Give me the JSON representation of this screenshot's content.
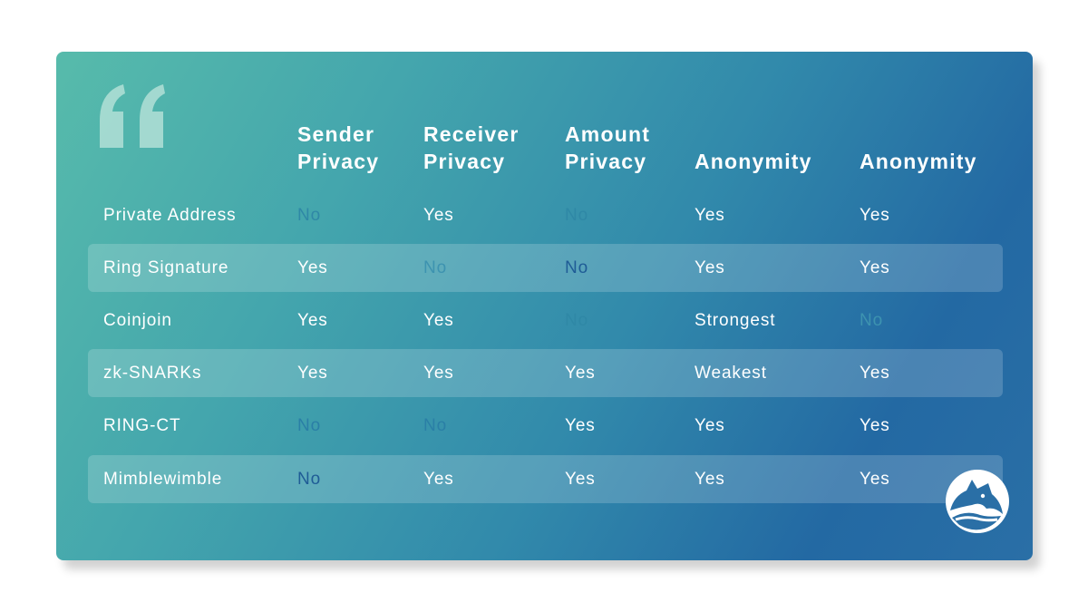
{
  "columns": [
    {
      "line1": "Sender",
      "line2": "Privacy"
    },
    {
      "line1": "Receiver",
      "line2": "Privacy"
    },
    {
      "line1": "Amount",
      "line2": "Privacy"
    },
    {
      "line1": "",
      "line2": "Anonymity"
    },
    {
      "line1": "",
      "line2": "Anonymity"
    }
  ],
  "rows": [
    {
      "label": "Private Address",
      "cells": [
        "No",
        "Yes",
        "No",
        "Yes",
        "Yes"
      ]
    },
    {
      "label": "Ring Signature",
      "cells": [
        "Yes",
        "No",
        "No",
        "Yes",
        "Yes"
      ]
    },
    {
      "label": "Coinjoin",
      "cells": [
        "Yes",
        "Yes",
        "No",
        "Strongest",
        "No"
      ]
    },
    {
      "label": "zk-SNARKs",
      "cells": [
        "Yes",
        "Yes",
        "Yes",
        "Weakest",
        "Yes"
      ]
    },
    {
      "label": "RING-CT",
      "cells": [
        "No",
        "No",
        "Yes",
        "Yes",
        "Yes"
      ]
    },
    {
      "label": "Mimblewimble",
      "cells": [
        "No",
        "Yes",
        "Yes",
        "Yes",
        "Yes"
      ]
    }
  ],
  "colors": {
    "gradient_start": "#57bbab",
    "gradient_end": "#2369a3",
    "yes_text": "#ffffff",
    "no_text": "#2a7fa6"
  },
  "icons": {
    "quote": "quote-mark-icon",
    "logo": "wolf-head-logo-icon"
  }
}
